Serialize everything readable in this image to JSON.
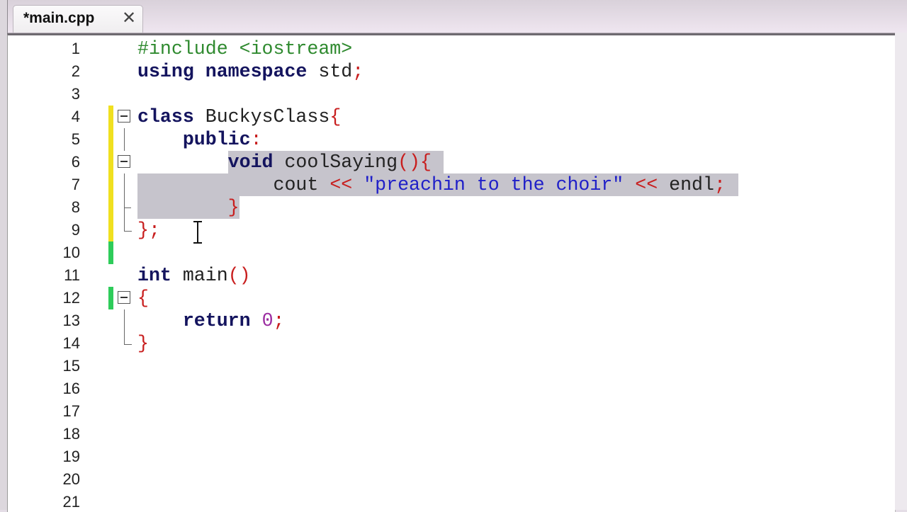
{
  "tab": {
    "label": "*main.cpp",
    "close_icon": "close-icon"
  },
  "colors": {
    "modified_marker": "#f0e020",
    "saved_marker": "#2ecc5a",
    "selection": "#c6c4cc"
  },
  "selection": {
    "start": {
      "line": 6,
      "col": 8
    },
    "end": {
      "line": 8,
      "col": 9
    }
  },
  "lines": [
    {
      "n": "1",
      "tokens": [
        [
          "pp",
          "#include <iostream>"
        ]
      ]
    },
    {
      "n": "2",
      "tokens": [
        [
          "kw",
          "using"
        ],
        [
          "id",
          " "
        ],
        [
          "kw",
          "namespace"
        ],
        [
          "id",
          " std"
        ],
        [
          "op",
          ";"
        ]
      ]
    },
    {
      "n": "3",
      "tokens": []
    },
    {
      "n": "4",
      "fold": "box",
      "change": "modified",
      "tokens": [
        [
          "kw",
          "class"
        ],
        [
          "id",
          " BuckysClass"
        ],
        [
          "op",
          "{"
        ]
      ]
    },
    {
      "n": "5",
      "fold": "line",
      "change": "modified",
      "tokens": [
        [
          "id",
          "    "
        ],
        [
          "kw",
          "public"
        ],
        [
          "op",
          ":"
        ]
      ]
    },
    {
      "n": "6",
      "fold": "box",
      "change": "modified",
      "tokens": [
        [
          "id",
          "        "
        ],
        [
          "kw",
          "void"
        ],
        [
          "id",
          " coolSaying"
        ],
        [
          "op",
          "(){"
        ]
      ]
    },
    {
      "n": "7",
      "fold": "line",
      "change": "modified",
      "tokens": [
        [
          "id",
          "            cout "
        ],
        [
          "op",
          "<<"
        ],
        [
          "id",
          " "
        ],
        [
          "str",
          "\"preachin to the choir\""
        ],
        [
          "id",
          " "
        ],
        [
          "op",
          "<<"
        ],
        [
          "id",
          " endl"
        ],
        [
          "op",
          ";"
        ]
      ]
    },
    {
      "n": "8",
      "fold": "tick",
      "change": "modified",
      "tokens": [
        [
          "id",
          "        "
        ],
        [
          "op",
          "}"
        ]
      ]
    },
    {
      "n": "9",
      "fold": "end",
      "change": "modified",
      "tokens": [
        [
          "op",
          "};"
        ]
      ]
    },
    {
      "n": "10",
      "change": "saved",
      "tokens": []
    },
    {
      "n": "11",
      "tokens": [
        [
          "kw",
          "int"
        ],
        [
          "id",
          " main"
        ],
        [
          "op",
          "()"
        ]
      ]
    },
    {
      "n": "12",
      "fold": "box",
      "change": "saved",
      "tokens": [
        [
          "op",
          "{"
        ]
      ]
    },
    {
      "n": "13",
      "fold": "line",
      "tokens": [
        [
          "id",
          "    "
        ],
        [
          "kw",
          "return"
        ],
        [
          "id",
          " "
        ],
        [
          "num",
          "0"
        ],
        [
          "op",
          ";"
        ]
      ]
    },
    {
      "n": "14",
      "fold": "end",
      "tokens": [
        [
          "op",
          "}"
        ]
      ]
    },
    {
      "n": "15",
      "tokens": []
    },
    {
      "n": "16",
      "tokens": []
    },
    {
      "n": "17",
      "tokens": []
    },
    {
      "n": "18",
      "tokens": []
    },
    {
      "n": "19",
      "tokens": []
    },
    {
      "n": "20",
      "tokens": []
    },
    {
      "n": "21",
      "tokens": []
    }
  ]
}
